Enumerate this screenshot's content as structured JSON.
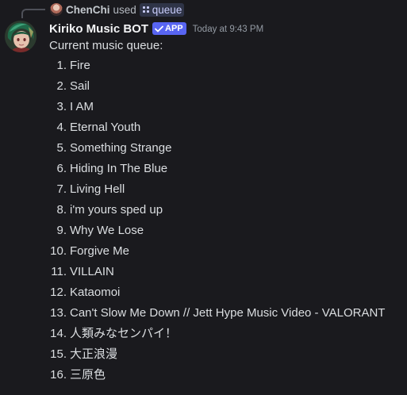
{
  "reply": {
    "username": "ChenChi",
    "used_text": "used",
    "command": "queue"
  },
  "author": {
    "name": "Kiriko Music BOT",
    "badge": "APP",
    "timestamp": "Today at 9:43 PM"
  },
  "message": {
    "intro": "Current music queue:",
    "queue": [
      {
        "num": "1.",
        "title": "Fire"
      },
      {
        "num": "2.",
        "title": "Sail"
      },
      {
        "num": "3.",
        "title": "I AM"
      },
      {
        "num": "4.",
        "title": "Eternal Youth"
      },
      {
        "num": "5.",
        "title": "Something Strange"
      },
      {
        "num": "6.",
        "title": "Hiding In The Blue"
      },
      {
        "num": "7.",
        "title": "Living Hell"
      },
      {
        "num": "8.",
        "title": "i'm yours sped up"
      },
      {
        "num": "9.",
        "title": "Why We Lose"
      },
      {
        "num": "10.",
        "title": "Forgive Me"
      },
      {
        "num": "11.",
        "title": "VILLAIN"
      },
      {
        "num": "12.",
        "title": "Kataomoi"
      },
      {
        "num": "13.",
        "title": "Can't Slow Me Down // Jett Hype Music Video - VALORANT"
      },
      {
        "num": "14.",
        "title": "人類みなセンパイ！"
      },
      {
        "num": "15.",
        "title": "大正浪漫"
      },
      {
        "num": "16.",
        "title": "三原色"
      }
    ]
  },
  "icons": {
    "command": "slash-command-icon",
    "verified": "checkmark-icon"
  },
  "colors": {
    "background": "#1a1a1e",
    "badge": "#5865f2",
    "command_pill": "#2f3447",
    "text": "#dbdee1",
    "muted": "#949ba4"
  }
}
